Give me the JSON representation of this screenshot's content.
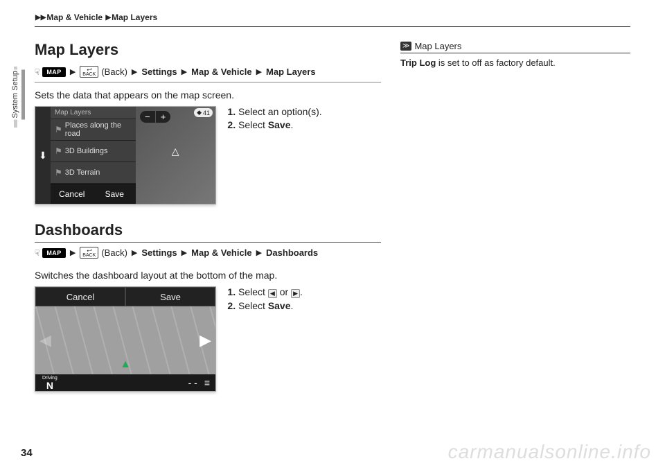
{
  "breadcrumb": {
    "a": "Map & Vehicle",
    "b": "Map Layers"
  },
  "tab": "System Setup",
  "section1": {
    "title": "Map Layers",
    "path": {
      "map": "MAP",
      "back": "BACK",
      "back_label": "(Back)",
      "p1": "Settings",
      "p2": "Map & Vehicle",
      "p3": "Map Layers"
    },
    "desc": "Sets the data that appears on the map screen.",
    "screenshot": {
      "title": "Map Layers",
      "opt1": "Places along the road",
      "opt2": "3D Buildings",
      "opt3": "3D Terrain",
      "cancel": "Cancel",
      "save": "Save",
      "route": "41"
    },
    "steps": {
      "s1": "Select an option(s).",
      "s2_a": "Select ",
      "s2_b": "Save",
      "s2_c": "."
    }
  },
  "section2": {
    "title": "Dashboards",
    "path": {
      "map": "MAP",
      "back": "BACK",
      "back_label": "(Back)",
      "p1": "Settings",
      "p2": "Map & Vehicle",
      "p3": "Dashboards"
    },
    "desc": "Switches the dashboard layout at the bottom of the map.",
    "screenshot": {
      "cancel": "Cancel",
      "save": "Save",
      "driving": "Driving",
      "n": "N",
      "dash": "- -"
    },
    "steps": {
      "s1_a": "Select ",
      "s1_b": " or ",
      "s1_c": ".",
      "s2_a": "Select ",
      "s2_b": "Save",
      "s2_c": "."
    }
  },
  "right": {
    "title": "Map Layers",
    "body_a": "Trip Log",
    "body_b": " is set to off as factory default."
  },
  "pagenum": "34",
  "watermark": "carmanualsonline.info"
}
